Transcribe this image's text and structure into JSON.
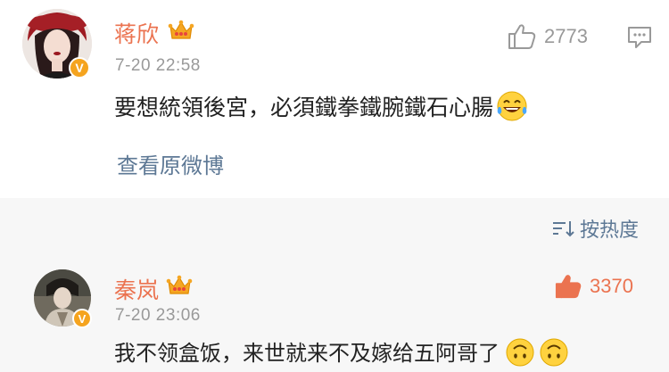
{
  "main_comment": {
    "author": "蒋欣",
    "timestamp": "7-20 22:58",
    "text": "要想統領後宮，必須鐵拳鐵腕鐵石心腸",
    "like_count": "2773",
    "view_original_link": "查看原微博",
    "badge": "V",
    "emoji": "laughing-tears"
  },
  "sort_control": {
    "label": "按热度"
  },
  "reply": {
    "author": "秦岚",
    "timestamp": "7-20 23:06",
    "text": "我不领盒饭，来世就来不及嫁给五阿哥了",
    "like_count": "3370",
    "badge": "V",
    "emojis": [
      "upside-down-face",
      "upside-down-face"
    ]
  },
  "colors": {
    "name": "#eb7350",
    "link": "#5d7895",
    "liked": "#eb7350",
    "muted": "#999999",
    "badge": "#f5a41f"
  }
}
